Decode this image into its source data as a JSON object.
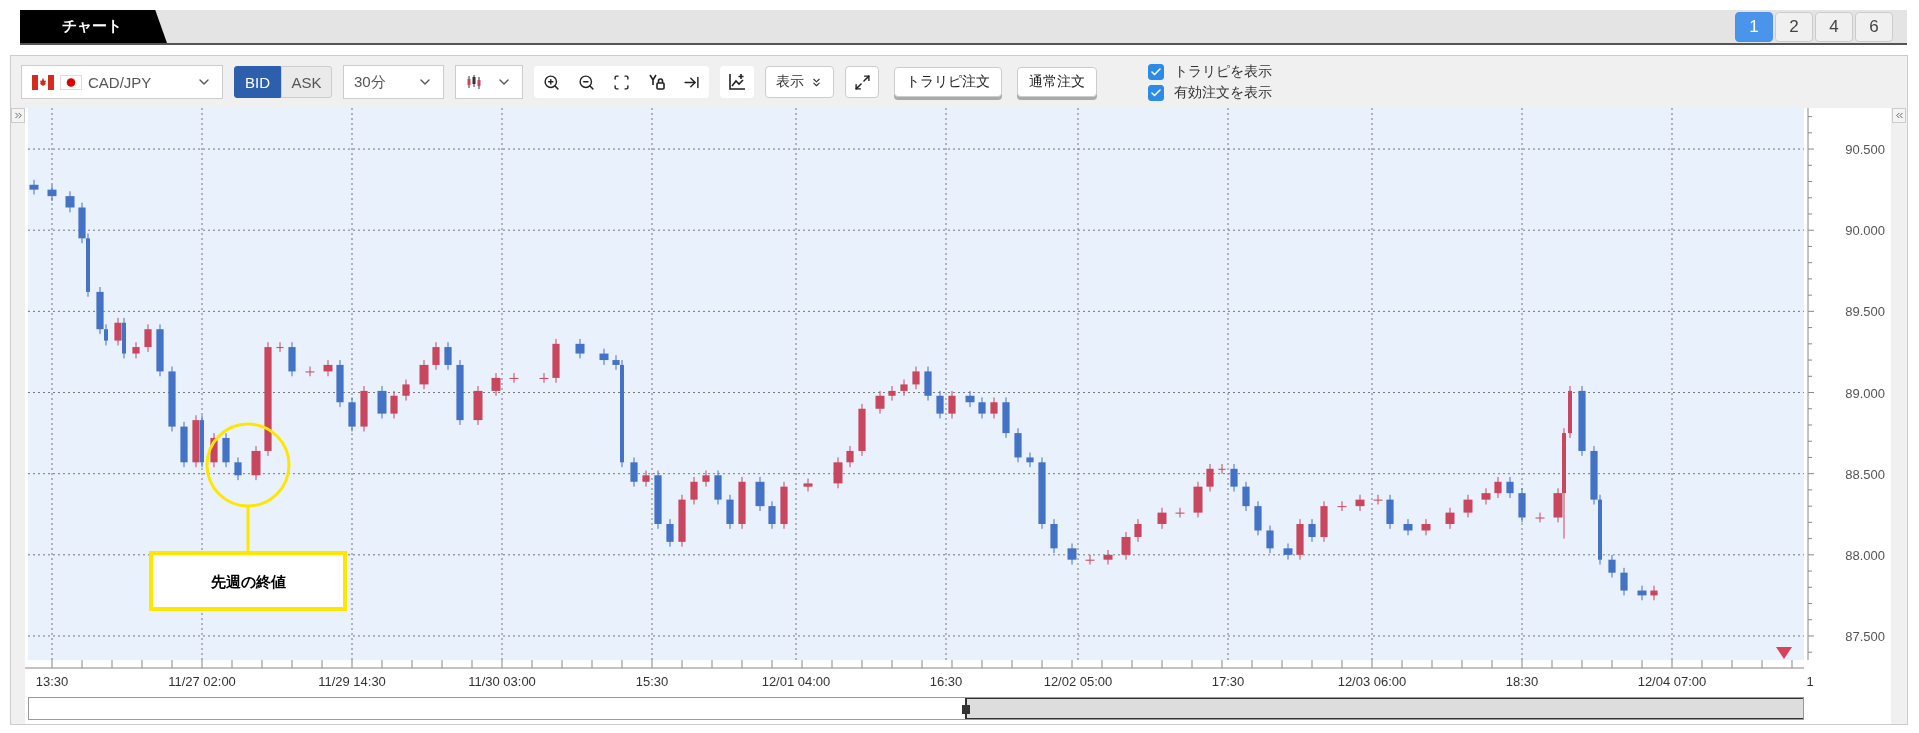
{
  "tab": {
    "label": "チャート"
  },
  "layout_buttons": [
    {
      "label": "1",
      "selected": true
    },
    {
      "label": "2",
      "selected": false
    },
    {
      "label": "4",
      "selected": false
    },
    {
      "label": "6",
      "selected": false
    }
  ],
  "toolbar": {
    "price_sides": [
      {
        "label": "BID",
        "selected": true
      },
      {
        "label": "ASK",
        "selected": false
      }
    ],
    "timeframe": "30分",
    "display_menu": "表示",
    "order_buttons": [
      "トラリピ注文",
      "通常注文"
    ],
    "checkboxes": [
      {
        "label": "トラリピを表示",
        "checked": true
      },
      {
        "label": "有効注文を表示",
        "checked": true
      }
    ]
  },
  "chart": {
    "chart_data": {
      "type": "candlestick",
      "categories": [
        null,
        null,
        null,
        null,
        "13:30",
        null,
        null,
        null,
        null,
        null,
        null,
        null,
        null,
        null,
        null,
        null,
        null,
        null,
        null,
        null,
        null,
        null,
        null,
        null,
        null,
        null,
        null,
        null,
        null,
        "11/27 02:00",
        null,
        null,
        null,
        null,
        null,
        null,
        null,
        null,
        null,
        null,
        null,
        null,
        null,
        null,
        null,
        null,
        null,
        null,
        null,
        null,
        null,
        null,
        null,
        null,
        "11/29 14:30",
        null,
        null,
        null,
        null,
        null,
        null,
        null,
        null,
        null,
        null,
        null,
        null,
        null,
        null,
        null,
        null,
        null,
        null,
        null,
        null,
        null,
        null,
        null,
        null,
        "11/30 03:00",
        null,
        null,
        null,
        null,
        null,
        null,
        null,
        null,
        null,
        null,
        null,
        null,
        null,
        null,
        null,
        null,
        null,
        null,
        null,
        null,
        null,
        null,
        null,
        null,
        "15:30",
        null,
        null,
        null,
        null,
        null,
        null,
        null,
        null,
        null,
        null,
        null,
        null,
        null,
        null,
        null,
        null,
        null,
        null,
        null,
        null,
        null,
        null,
        null,
        "12/01 04:00",
        null,
        null,
        null,
        null,
        null,
        null,
        null,
        null,
        null,
        null,
        null,
        null,
        null,
        null,
        null,
        null,
        null,
        null,
        null,
        null,
        null,
        null,
        null,
        null,
        "16:30",
        null,
        null,
        null,
        null,
        null,
        null,
        null,
        null,
        null,
        null,
        null,
        null,
        null,
        null,
        null,
        null,
        null,
        null,
        null,
        null,
        null,
        "12/02 05:00",
        null,
        null,
        null,
        null,
        null,
        null,
        null,
        null,
        null,
        null,
        null,
        null,
        null,
        null,
        null,
        null,
        null,
        null,
        null,
        null,
        null,
        null,
        null,
        null,
        "17:30",
        null,
        null,
        null,
        null,
        null,
        null,
        null,
        null,
        null,
        null,
        null,
        null,
        null,
        null,
        null,
        null,
        null,
        null,
        null,
        null,
        null,
        null,
        null,
        "12/03 06:00",
        null,
        null,
        null,
        null,
        null,
        null,
        null,
        null,
        null,
        null,
        null,
        null,
        null,
        null,
        null,
        null,
        null,
        null,
        null,
        null,
        null,
        null,
        null,
        null,
        "18:30",
        null,
        null,
        null,
        null,
        null,
        null,
        null,
        null,
        null,
        null,
        null,
        null,
        null,
        null,
        null,
        null,
        null,
        null,
        null,
        null,
        null,
        null,
        null,
        null,
        "12/04 07:00",
        null,
        null,
        null,
        null,
        null,
        null,
        null,
        null,
        null,
        null,
        null,
        null,
        null,
        null,
        null,
        null,
        null,
        null,
        null,
        null,
        null,
        null,
        "1"
      ],
      "grid": true,
      "series": [
        {
          "name": "CAD/JPY",
          "ohlc": [
            null,
            [
              90.28,
              90.31,
              90.22,
              90.25
            ],
            null,
            null,
            [
              90.25,
              90.28,
              90.18,
              90.21
            ],
            null,
            null,
            [
              90.21,
              90.24,
              90.11,
              90.14
            ],
            null,
            [
              90.14,
              90.17,
              89.92,
              89.95
            ],
            [
              89.95,
              89.98,
              89.59,
              89.62
            ],
            null,
            [
              89.62,
              89.65,
              89.36,
              89.39
            ],
            [
              89.39,
              89.42,
              89.29,
              89.32
            ],
            null,
            [
              89.32,
              89.46,
              89.29,
              89.43
            ],
            [
              89.43,
              89.46,
              89.21,
              89.24
            ],
            null,
            [
              89.24,
              89.31,
              89.21,
              89.28
            ],
            null,
            [
              89.28,
              89.42,
              89.25,
              89.39
            ],
            null,
            [
              89.39,
              89.42,
              89.1,
              89.13
            ],
            null,
            [
              89.13,
              89.16,
              88.76,
              88.79
            ],
            null,
            [
              88.79,
              88.82,
              88.54,
              88.57
            ],
            null,
            [
              88.57,
              88.86,
              88.54,
              88.83
            ],
            [
              88.83,
              88.86,
              88.54,
              88.57
            ],
            null,
            [
              88.57,
              88.75,
              88.54,
              88.72
            ],
            null,
            [
              88.72,
              88.75,
              88.54,
              88.57
            ],
            null,
            [
              88.57,
              88.6,
              88.46,
              88.49
            ],
            null,
            null,
            [
              88.49,
              88.67,
              88.46,
              88.64
            ],
            null,
            [
              88.64,
              89.31,
              88.61,
              89.28
            ],
            null,
            [
              89.28,
              89.31,
              89.25,
              89.28
            ],
            null,
            [
              89.28,
              89.31,
              89.1,
              89.13
            ],
            null,
            null,
            [
              89.13,
              89.16,
              89.1,
              89.13
            ],
            null,
            null,
            [
              89.13,
              89.2,
              89.1,
              89.17
            ],
            null,
            [
              89.17,
              89.2,
              88.91,
              88.94
            ],
            null,
            [
              88.94,
              88.97,
              88.76,
              88.79
            ],
            null,
            [
              88.79,
              89.04,
              88.76,
              89.01
            ],
            null,
            null,
            [
              89.01,
              89.04,
              88.84,
              88.87
            ],
            null,
            [
              88.87,
              89.01,
              88.84,
              88.98
            ],
            null,
            [
              88.98,
              89.08,
              88.95,
              89.05
            ],
            null,
            null,
            [
              89.05,
              89.2,
              89.02,
              89.17
            ],
            null,
            [
              89.17,
              89.31,
              89.14,
              89.28
            ],
            null,
            [
              89.28,
              89.31,
              89.14,
              89.17
            ],
            null,
            [
              89.17,
              89.2,
              88.8,
              88.83
            ],
            null,
            null,
            [
              88.83,
              89.04,
              88.8,
              89.01
            ],
            null,
            null,
            [
              89.01,
              89.12,
              88.98,
              89.09
            ],
            null,
            null,
            [
              89.09,
              89.12,
              89.06,
              89.09
            ],
            null,
            null,
            null,
            null,
            [
              89.09,
              89.12,
              89.06,
              89.09
            ],
            null,
            [
              89.09,
              89.33,
              89.06,
              89.3
            ],
            null,
            null,
            null,
            [
              89.3,
              89.33,
              89.21,
              89.24
            ],
            null,
            null,
            null,
            [
              89.24,
              89.27,
              89.17,
              89.2
            ],
            null,
            [
              89.2,
              89.23,
              89.14,
              89.17
            ],
            [
              89.17,
              89.2,
              88.54,
              88.57
            ],
            null,
            [
              88.57,
              88.6,
              88.42,
              88.45
            ],
            null,
            [
              88.45,
              88.52,
              88.42,
              88.49
            ],
            null,
            [
              88.49,
              88.52,
              88.16,
              88.19
            ],
            null,
            [
              88.19,
              88.22,
              88.05,
              88.08
            ],
            null,
            [
              88.08,
              88.37,
              88.05,
              88.34
            ],
            null,
            [
              88.34,
              88.48,
              88.31,
              88.45
            ],
            null,
            [
              88.45,
              88.52,
              88.42,
              88.49
            ],
            null,
            [
              88.49,
              88.52,
              88.31,
              88.34
            ],
            null,
            [
              88.34,
              88.37,
              88.16,
              88.19
            ],
            null,
            [
              88.19,
              88.48,
              88.16,
              88.45
            ],
            null,
            null,
            [
              88.45,
              88.48,
              88.27,
              88.3
            ],
            null,
            [
              88.3,
              88.33,
              88.16,
              88.19
            ],
            null,
            [
              88.19,
              88.45,
              88.16,
              88.42
            ],
            null,
            null,
            null,
            [
              88.42,
              88.47,
              88.39,
              88.44
            ],
            null,
            null,
            null,
            null,
            [
              88.44,
              88.6,
              88.41,
              88.57
            ],
            null,
            [
              88.57,
              88.67,
              88.54,
              88.64
            ],
            null,
            [
              88.64,
              88.93,
              88.61,
              88.9
            ],
            null,
            null,
            [
              88.9,
              89.01,
              88.87,
              88.98
            ],
            null,
            [
              88.98,
              89.04,
              88.95,
              89.01
            ],
            null,
            [
              89.01,
              89.08,
              88.98,
              89.05
            ],
            null,
            [
              89.05,
              89.16,
              89.02,
              89.13
            ],
            null,
            [
              89.13,
              89.16,
              88.95,
              88.98
            ],
            null,
            [
              88.98,
              89.01,
              88.84,
              88.87
            ],
            null,
            [
              88.87,
              89.01,
              88.84,
              88.98
            ],
            null,
            null,
            [
              88.98,
              89.01,
              88.91,
              88.94
            ],
            null,
            [
              88.94,
              88.97,
              88.84,
              88.87
            ],
            null,
            [
              88.87,
              88.97,
              88.84,
              88.94
            ],
            null,
            [
              88.94,
              88.97,
              88.72,
              88.75
            ],
            null,
            [
              88.75,
              88.78,
              88.57,
              88.6
            ],
            null,
            [
              88.6,
              88.63,
              88.54,
              88.57
            ],
            null,
            [
              88.57,
              88.6,
              88.16,
              88.19
            ],
            null,
            [
              88.19,
              88.22,
              88.01,
              88.04
            ],
            null,
            null,
            [
              88.04,
              88.07,
              87.94,
              87.97
            ],
            null,
            null,
            [
              87.97,
              88.0,
              87.94,
              87.97
            ],
            null,
            null,
            [
              87.97,
              88.03,
              87.94,
              88.0
            ],
            null,
            null,
            [
              88.0,
              88.14,
              87.97,
              88.11
            ],
            null,
            [
              88.11,
              88.22,
              88.08,
              88.19
            ],
            null,
            null,
            null,
            [
              88.19,
              88.29,
              88.16,
              88.26
            ],
            null,
            null,
            [
              88.26,
              88.29,
              88.23,
              88.26
            ],
            null,
            null,
            [
              88.26,
              88.45,
              88.23,
              88.42
            ],
            null,
            [
              88.42,
              88.56,
              88.39,
              88.53
            ],
            null,
            [
              88.53,
              88.56,
              88.5,
              88.53
            ],
            null,
            [
              88.53,
              88.56,
              88.39,
              88.42
            ],
            null,
            [
              88.42,
              88.45,
              88.27,
              88.3
            ],
            null,
            [
              88.3,
              88.33,
              88.12,
              88.15
            ],
            null,
            [
              88.15,
              88.18,
              88.01,
              88.04
            ],
            null,
            null,
            [
              88.04,
              88.07,
              87.97,
              88.0
            ],
            null,
            [
              88.0,
              88.22,
              87.97,
              88.19
            ],
            null,
            [
              88.19,
              88.22,
              88.08,
              88.11
            ],
            null,
            [
              88.11,
              88.33,
              88.08,
              88.3
            ],
            null,
            null,
            [
              88.3,
              88.33,
              88.27,
              88.3
            ],
            null,
            null,
            [
              88.3,
              88.37,
              88.27,
              88.34
            ],
            null,
            null,
            [
              88.34,
              88.37,
              88.31,
              88.34
            ],
            null,
            [
              88.34,
              88.37,
              88.16,
              88.19
            ],
            null,
            null,
            [
              88.19,
              88.22,
              88.12,
              88.15
            ],
            null,
            null,
            [
              88.15,
              88.22,
              88.12,
              88.19
            ],
            null,
            null,
            null,
            [
              88.19,
              88.29,
              88.16,
              88.26
            ],
            null,
            null,
            [
              88.26,
              88.37,
              88.23,
              88.34
            ],
            null,
            null,
            [
              88.34,
              88.41,
              88.31,
              88.38
            ],
            null,
            [
              88.38,
              88.48,
              88.35,
              88.45
            ],
            null,
            [
              88.45,
              88.48,
              88.35,
              88.38
            ],
            null,
            [
              88.38,
              88.41,
              88.2,
              88.23
            ],
            null,
            null,
            [
              88.23,
              88.26,
              88.2,
              88.23
            ],
            null,
            null,
            [
              88.23,
              88.41,
              88.2,
              88.38
            ],
            [
              88.38,
              88.78,
              88.1,
              88.75
            ],
            [
              88.75,
              89.04,
              88.72,
              89.01
            ],
            null,
            [
              89.01,
              89.04,
              88.61,
              88.64
            ],
            null,
            [
              88.64,
              88.67,
              88.31,
              88.34
            ],
            [
              88.34,
              88.37,
              87.94,
              87.97
            ],
            null,
            [
              87.97,
              88.0,
              87.86,
              87.89
            ],
            null,
            [
              87.89,
              87.92,
              87.75,
              87.78
            ],
            null,
            null,
            [
              87.78,
              87.81,
              87.72,
              87.75
            ],
            null,
            [
              87.75,
              87.81,
              87.72,
              87.78
            ],
            null,
            null,
            null,
            null,
            null,
            null,
            null,
            null,
            null,
            null,
            null,
            null,
            null,
            null,
            null,
            null,
            null,
            null,
            null,
            null,
            null,
            null,
            null,
            null,
            null,
            null
          ]
        }
      ],
      "ylim": [
        87.352,
        90.753
      ],
      "yticks": [
        {
          "value": 87.5,
          "label": "87.500"
        },
        {
          "value": 88,
          "label": "88.000"
        },
        {
          "value": 88.5,
          "label": "88.500"
        },
        {
          "value": 89,
          "label": "89.000"
        },
        {
          "value": 89.5,
          "label": "89.500"
        },
        {
          "value": 90,
          "label": "90.000"
        },
        {
          "value": 90.5,
          "label": "90.500"
        }
      ],
      "annotations": [
        "先週の終値"
      ]
    }
  }
}
